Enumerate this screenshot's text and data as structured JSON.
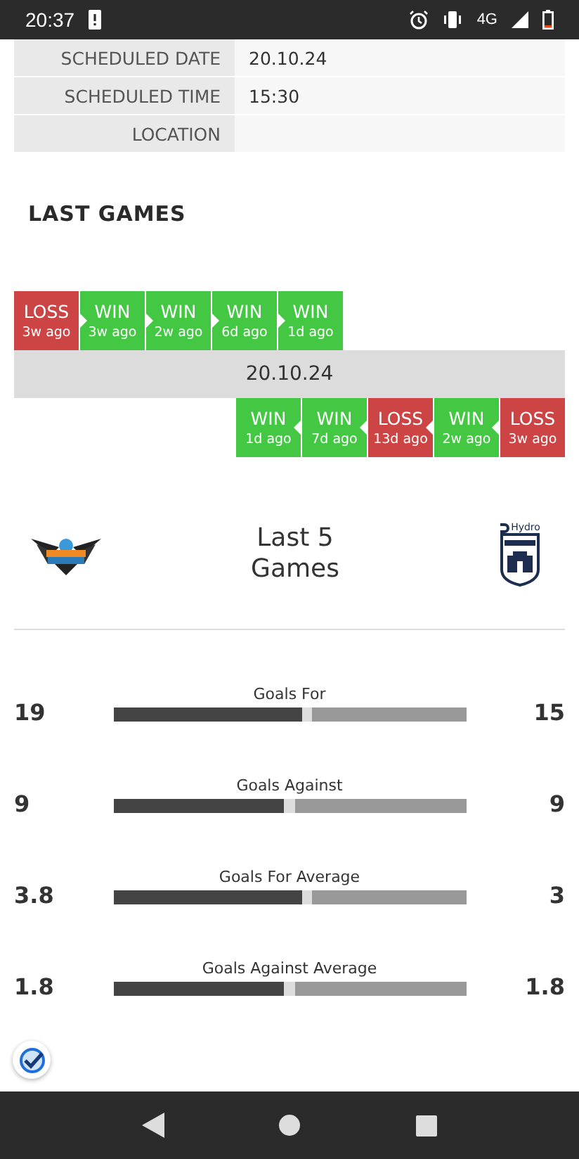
{
  "status_bar": {
    "time": "20:37",
    "network": "4G"
  },
  "details": [
    {
      "label": "SCHEDULED DATE",
      "value": "20.10.24"
    },
    {
      "label": "SCHEDULED TIME",
      "value": "15:30"
    },
    {
      "label": "LOCATION"
    }
  ],
  "last_games": {
    "title": "LAST GAMES",
    "date": "20.10.24",
    "home": [
      {
        "result": "LOSS",
        "kind": "loss",
        "ago": "3w ago"
      },
      {
        "result": "WIN",
        "kind": "win",
        "ago": "3w ago"
      },
      {
        "result": "WIN",
        "kind": "win",
        "ago": "2w ago"
      },
      {
        "result": "WIN",
        "kind": "win",
        "ago": "6d ago"
      },
      {
        "result": "WIN",
        "kind": "win",
        "ago": "1d ago"
      }
    ],
    "away": [
      {
        "result": "WIN",
        "kind": "win",
        "ago": "1d ago"
      },
      {
        "result": "WIN",
        "kind": "win",
        "ago": "7d ago"
      },
      {
        "result": "LOSS",
        "kind": "loss",
        "ago": "13d ago"
      },
      {
        "result": "WIN",
        "kind": "win",
        "ago": "2w ago"
      },
      {
        "result": "LOSS",
        "kind": "loss",
        "ago": "3w ago"
      }
    ]
  },
  "comparison": {
    "title": "Last 5 Games",
    "away_sponsor": "Hydro",
    "stats": [
      {
        "label": "Goals For",
        "home": "19",
        "away": "15",
        "level": 0.55
      },
      {
        "label": "Goals Against",
        "home": "9",
        "away": "9",
        "level": 0.5
      },
      {
        "label": "Goals For Average",
        "home": "3.8",
        "away": "3",
        "level": 0.55
      },
      {
        "label": "Goals Against Average",
        "home": "1.8",
        "away": "1.8",
        "level": 0.5
      }
    ]
  }
}
